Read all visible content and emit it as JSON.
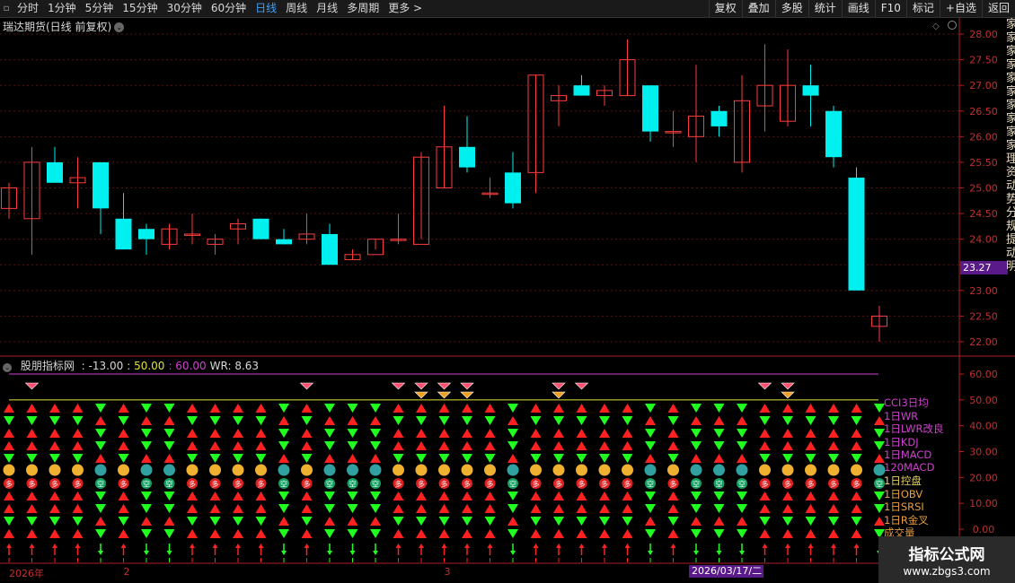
{
  "toolbar": {
    "periods": [
      "分时",
      "1分钟",
      "5分钟",
      "15分钟",
      "30分钟",
      "60分钟",
      "日线",
      "周线",
      "月线",
      "多周期",
      "更多 >"
    ],
    "active_period": "日线",
    "right_buttons": [
      "复权",
      "叠加",
      "多股",
      "统计",
      "画线",
      "F10",
      "标记",
      "+自选",
      "返回"
    ]
  },
  "stock": {
    "title": "瑞达期货(日线 前复权)"
  },
  "price_axis": {
    "labels": [
      "28.00",
      "27.50",
      "27.00",
      "26.50",
      "26.00",
      "25.50",
      "25.00",
      "24.50",
      "24.00",
      "23.50",
      "23.00",
      "22.50",
      "22.00"
    ],
    "current_price": "23.27"
  },
  "indicator": {
    "name": "股朋指标网",
    "values": [
      {
        "text": ": -13.00",
        "color": "#d8d8d8"
      },
      {
        "text": ": 50.00",
        "color": "#e0e040"
      },
      {
        "text": ": 60.00",
        "color": "#d040d0"
      },
      {
        "text": "WR: 8.63",
        "color": "#d8d8d8"
      }
    ],
    "axis_labels": [
      "60.00",
      "50.00",
      "40.00",
      "30.00",
      "20.00",
      "10.00",
      "0.00"
    ],
    "legend": [
      {
        "label": "CCI3日均",
        "color": "#d040d0"
      },
      {
        "label": "1日WR",
        "color": "#d040d0"
      },
      {
        "label": "1日LWR改良",
        "color": "#d040d0"
      },
      {
        "label": "1日KDJ",
        "color": "#d040d0"
      },
      {
        "label": "1日MACD",
        "color": "#d040d0"
      },
      {
        "label": "120MACD",
        "color": "#d040d0"
      },
      {
        "label": "1日控盘",
        "color": "#e8d060"
      },
      {
        "label": "1日OBV",
        "color": "#e8a040"
      },
      {
        "label": "1日SRSI",
        "color": "#e8a040"
      },
      {
        "label": "1日R金叉",
        "color": "#e8a040"
      },
      {
        "label": "成交量",
        "color": "#e8a040"
      }
    ],
    "badge_up": "多",
    "badge_down": "空"
  },
  "x_axis": {
    "labels": [
      {
        "text": "2026年",
        "pos": 0
      },
      {
        "text": "2",
        "pos": 5
      },
      {
        "text": "3",
        "pos": 19
      }
    ],
    "cursor_date": "2026/03/17/二"
  },
  "right_strip_text": "家家家家家家家家家家理资动势分规提动明",
  "watermark": {
    "line1": "指标公式网",
    "line2": "www.zbgs3.com"
  },
  "chart_data": {
    "type": "candlestick",
    "y_range": [
      21.8,
      28.2
    ],
    "ohlc": [
      [
        24.6,
        25.1,
        24.4,
        25.0
      ],
      [
        24.4,
        25.8,
        23.7,
        25.5
      ],
      [
        25.5,
        25.8,
        25.1,
        25.1
      ],
      [
        25.1,
        25.6,
        24.6,
        25.2
      ],
      [
        25.5,
        25.5,
        24.1,
        24.6
      ],
      [
        24.4,
        24.9,
        23.8,
        23.8
      ],
      [
        24.2,
        24.3,
        23.7,
        24.0
      ],
      [
        23.9,
        24.3,
        23.8,
        24.2
      ],
      [
        24.1,
        24.5,
        23.9,
        24.1
      ],
      [
        23.9,
        24.1,
        23.7,
        24.0
      ],
      [
        24.2,
        24.4,
        23.9,
        24.3
      ],
      [
        24.4,
        24.4,
        24.0,
        24.0
      ],
      [
        24.0,
        24.2,
        23.9,
        23.9
      ],
      [
        24.0,
        24.5,
        23.9,
        24.1
      ],
      [
        24.1,
        24.3,
        23.6,
        23.5
      ],
      [
        23.6,
        23.8,
        23.6,
        23.7
      ],
      [
        23.7,
        24.0,
        23.8,
        24.0
      ],
      [
        24.0,
        24.5,
        23.9,
        24.0
      ],
      [
        23.9,
        25.7,
        24.0,
        25.6
      ],
      [
        25.0,
        26.6,
        25.0,
        25.8
      ],
      [
        25.8,
        26.4,
        25.3,
        25.4
      ],
      [
        24.9,
        25.2,
        24.8,
        24.9
      ],
      [
        25.3,
        25.7,
        24.6,
        24.7
      ],
      [
        25.3,
        27.2,
        24.9,
        27.2
      ],
      [
        26.7,
        27.0,
        26.2,
        26.8
      ],
      [
        27.0,
        27.2,
        26.8,
        26.8
      ],
      [
        26.8,
        27.0,
        26.6,
        26.9
      ],
      [
        26.8,
        27.9,
        26.8,
        27.5
      ],
      [
        27.0,
        27.0,
        25.9,
        26.1
      ],
      [
        26.1,
        26.5,
        25.8,
        26.1
      ],
      [
        26.0,
        27.4,
        25.5,
        26.4
      ],
      [
        26.5,
        26.6,
        26.0,
        26.2
      ],
      [
        25.5,
        27.2,
        25.3,
        26.7
      ],
      [
        26.6,
        27.8,
        26.1,
        27.0
      ],
      [
        26.3,
        27.7,
        26.2,
        27.0
      ],
      [
        27.0,
        27.4,
        26.2,
        26.8
      ],
      [
        26.5,
        26.6,
        25.4,
        25.6
      ],
      [
        25.2,
        25.4,
        23.0,
        23.0
      ],
      [
        22.3,
        22.7,
        22.0,
        22.5
      ]
    ],
    "signals_up": [
      0,
      1,
      2,
      3,
      5,
      8,
      9,
      10,
      11,
      13,
      17,
      18,
      19,
      20,
      21,
      23,
      24,
      25,
      26,
      27,
      29,
      33,
      34,
      35,
      36,
      37
    ]
  }
}
